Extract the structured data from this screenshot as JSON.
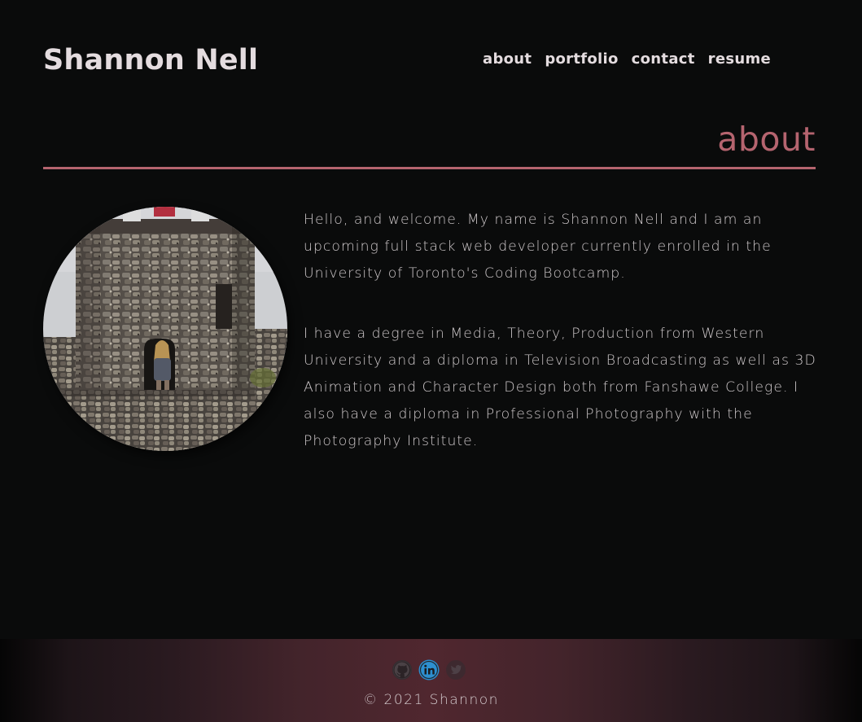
{
  "header": {
    "site_title": "Shannon Nell",
    "nav": [
      "about",
      "portfolio",
      "contact",
      "resume"
    ]
  },
  "about": {
    "heading": "about",
    "paragraphs": [
      "Hello, and welcome. My name is Shannon Nell and I am an upcoming full stack web developer currently enrolled in the University of Toronto's Coding Bootcamp.",
      "I have a degree in Media, Theory, Production from Western University and a diploma in Television Broadcasting as well as 3D Animation and Character Design both from Fanshawe College. I also have a diploma in Professional Photography with the Photography Institute."
    ]
  },
  "footer": {
    "social_icons": [
      "github-icon",
      "linkedin-icon",
      "twitter-icon"
    ],
    "copyright": "© 2021 Shannon"
  },
  "colors": {
    "background": "#0a0b0b",
    "accent": "#b5646f",
    "text": "#e4dcdf",
    "footer_center": "#50272f",
    "linkedin": "#2d8fd0"
  }
}
